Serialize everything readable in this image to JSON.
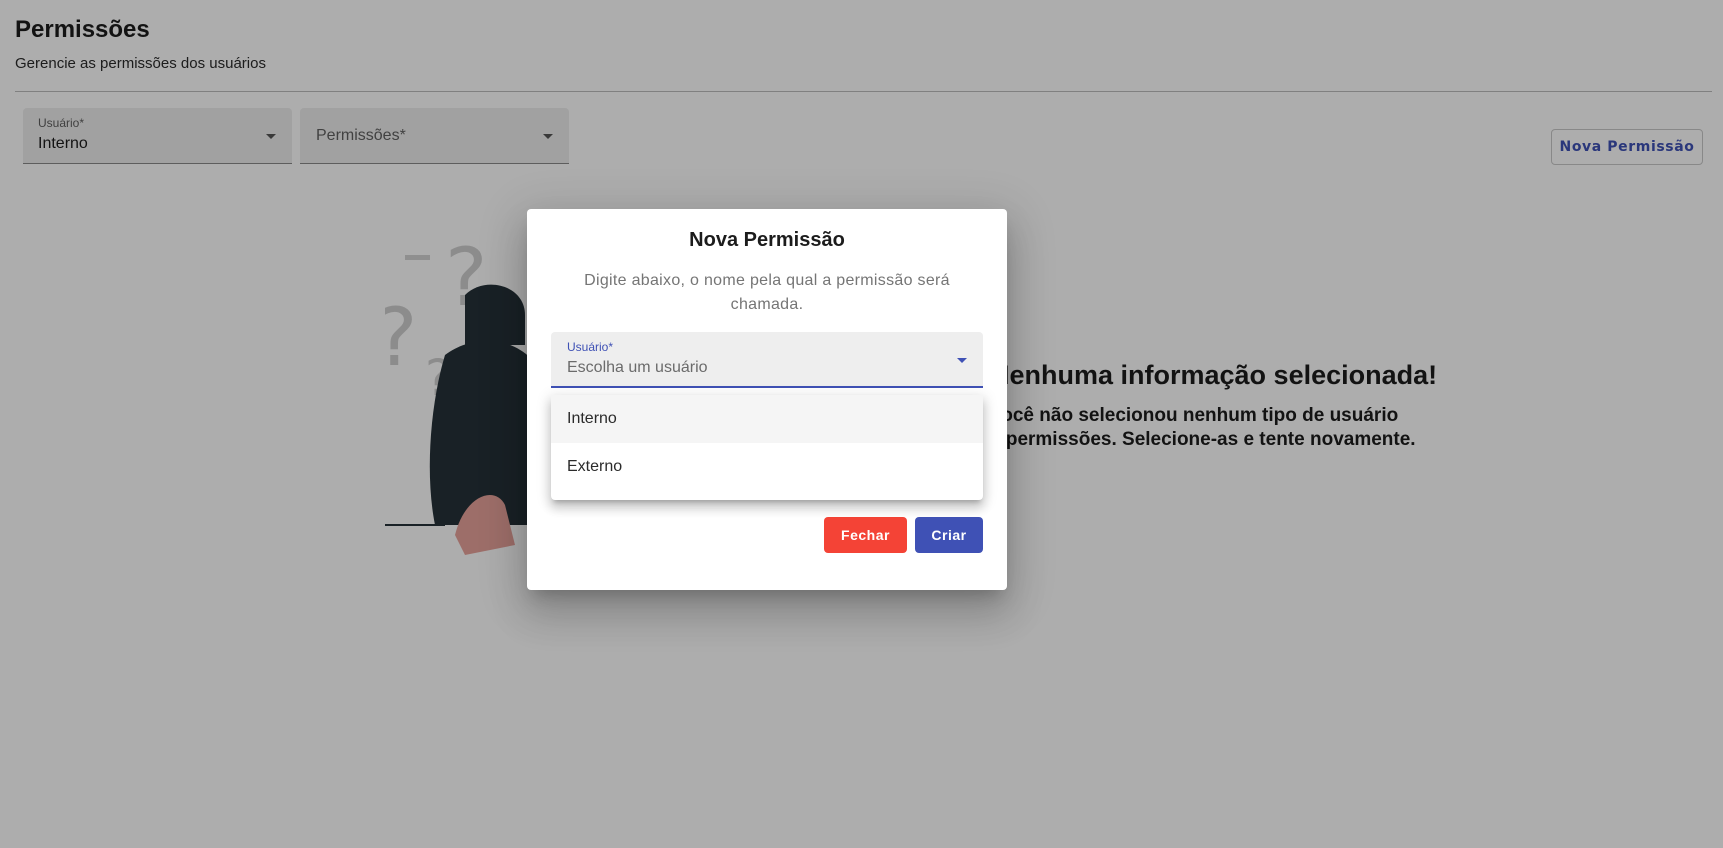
{
  "page": {
    "title": "Permissões",
    "subtitle": "Gerencie as permissões dos usuários"
  },
  "filters": {
    "user": {
      "label": "Usuário*",
      "value": "Interno"
    },
    "permissions": {
      "label": "Permissões*"
    }
  },
  "toolbar": {
    "new_permission_label": "Nova Permissão"
  },
  "empty_state": {
    "title": "Nenhuma informação selecionada!",
    "line1": "Você não selecionou nenhum tipo de usuário",
    "line2": "e permissões. Selecione-as e tente novamente."
  },
  "dialog": {
    "title": "Nova Permissão",
    "description": "Digite abaixo, o nome pela qual a permissão será chamada.",
    "user_select": {
      "label": "Usuário*",
      "placeholder": "Escolha um usuário"
    },
    "close_label": "Fechar",
    "create_label": "Criar"
  },
  "dropdown": {
    "options": [
      "Interno",
      "Externo"
    ],
    "highlighted_index": 0
  },
  "colors": {
    "primary": "#3f51b5",
    "danger": "#f44336",
    "overlay": "rgba(0,0,0,0.32)"
  },
  "icons": {
    "select_caret": "caret-down-icon",
    "illustration": "confused-person-illustration"
  }
}
